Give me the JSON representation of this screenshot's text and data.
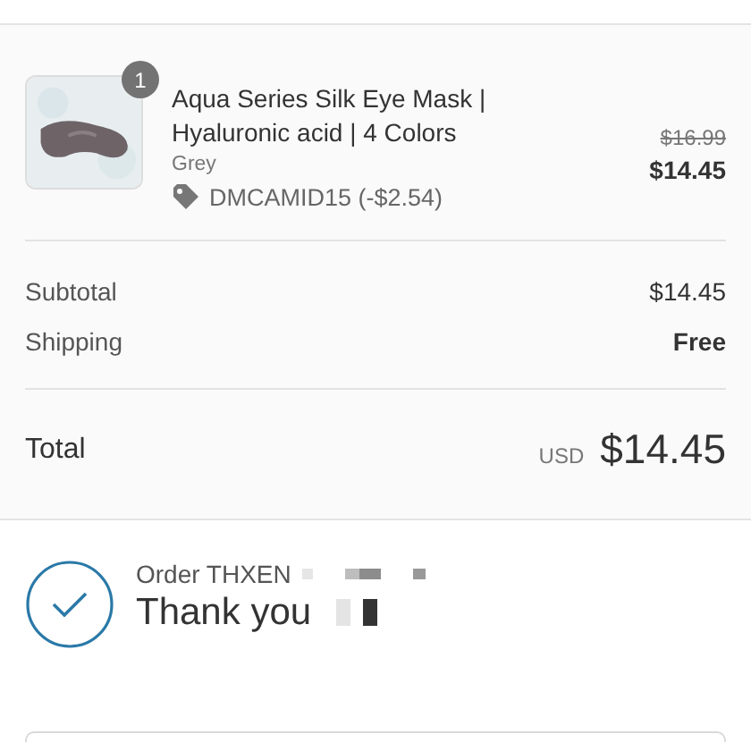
{
  "line_item": {
    "quantity": "1",
    "title": "Aqua Series Silk Eye Mask | Hyaluronic acid | 4 Colors",
    "variant": "Grey",
    "discount_code": "DMCAMID15 (-$2.54)",
    "original_price": "$16.99",
    "price": "$14.45"
  },
  "summary": [
    {
      "label": "Subtotal",
      "value": "$14.45",
      "kind": "plain"
    },
    {
      "label": "Shipping",
      "value": "Free",
      "kind": "bold"
    }
  ],
  "total": {
    "label": "Total",
    "currency": "USD",
    "amount": "$14.45"
  },
  "confirmation": {
    "order": "Order THXEN",
    "heading": "Thank you"
  }
}
